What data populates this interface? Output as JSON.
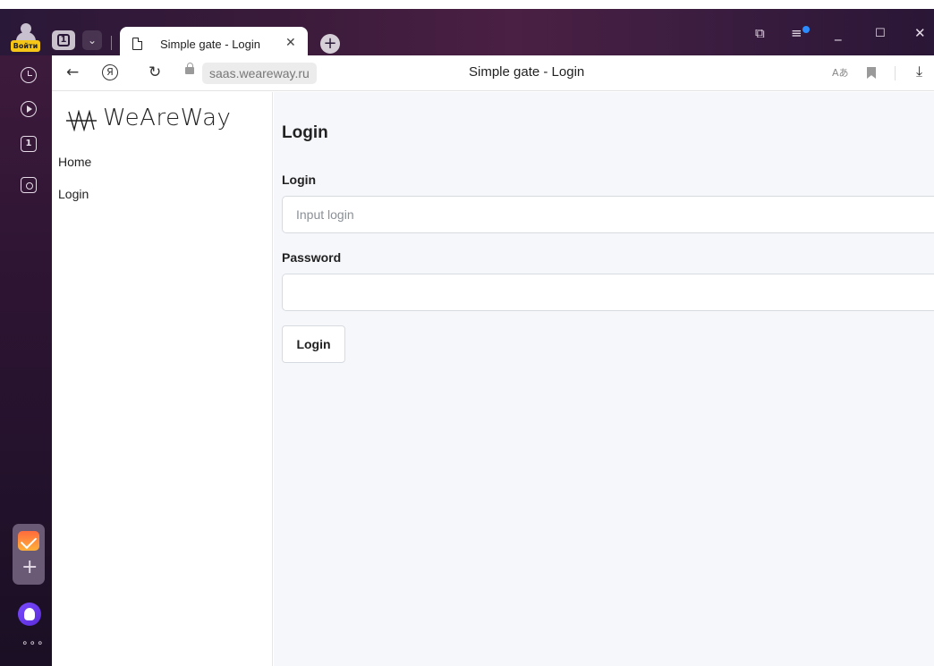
{
  "browser": {
    "profile_badge": "Войти",
    "tab_count": "1",
    "active_tab": {
      "title": "Simple gate - Login"
    },
    "address": {
      "url": "saas.weareway.ru",
      "page_title": "Simple gate - Login"
    },
    "colors": {
      "notification_dot": "#2b8cff",
      "profile_badge": "#f5c518"
    }
  },
  "sidebar": {
    "brand": "WeAreWay",
    "nav": [
      {
        "label": "Home"
      },
      {
        "label": "Login"
      }
    ]
  },
  "main": {
    "title": "Login",
    "form": {
      "login_label": "Login",
      "login_placeholder": "Input login",
      "login_value": "",
      "password_label": "Password",
      "password_value": "",
      "submit_label": "Login"
    }
  }
}
